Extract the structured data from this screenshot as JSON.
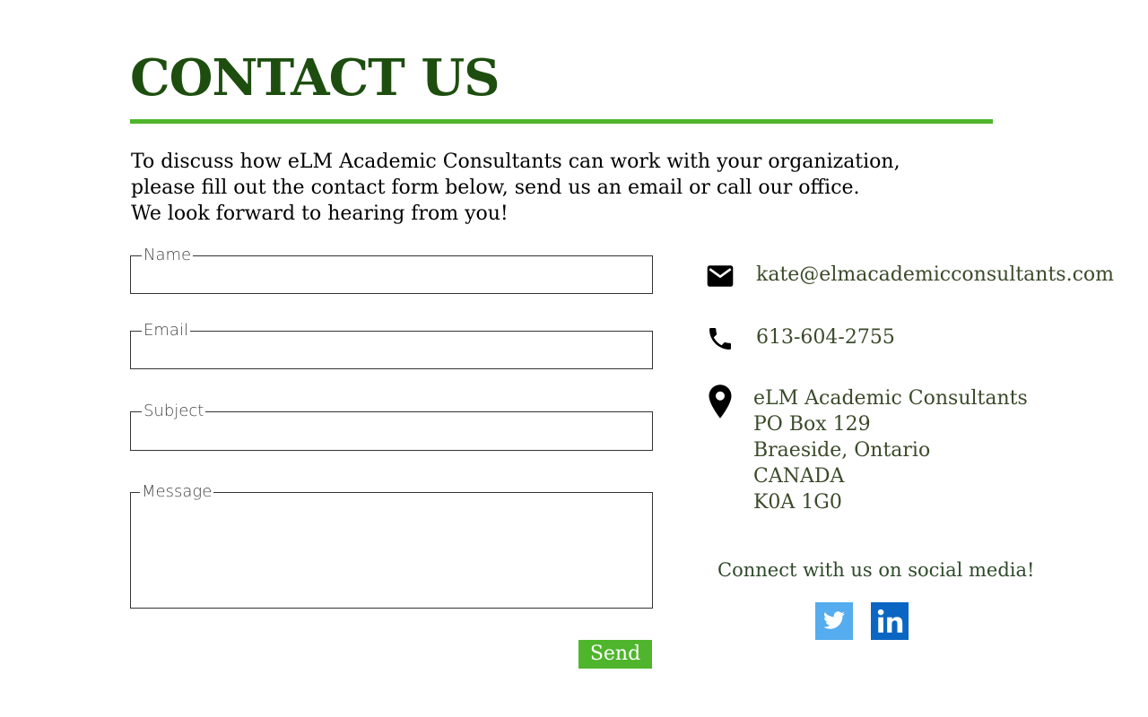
{
  "page": {
    "title": "CONTACT US",
    "intro_lines": [
      "To discuss how eLM Academic Consultants can work with your organization,",
      "please fill out the contact form below, send us an email or call our office.",
      "We look forward to hearing from you!"
    ]
  },
  "form": {
    "name_label": "Name",
    "name_value": "",
    "email_label": "Email",
    "email_value": "",
    "subject_label": "Subject",
    "subject_value": "",
    "message_label": "Message",
    "message_value": "",
    "send_label": "Send"
  },
  "contact": {
    "email": "kate@elmacademicconsultants.com",
    "phone": "613-604-2755",
    "address_lines": [
      "eLM Academic Consultants",
      "PO Box 129",
      "Braeside, Ontario",
      "CANADA",
      "K0A 1G0"
    ],
    "icons": [
      "mail-icon",
      "phone-icon",
      "location-pin-icon"
    ]
  },
  "social": {
    "heading": "Connect with us on social media!",
    "links": [
      {
        "name": "twitter-icon",
        "color": "#55acee"
      },
      {
        "name": "linkedin-icon",
        "color": "#0a66c2"
      }
    ]
  },
  "colors": {
    "title": "#1d4e0f",
    "accent": "#4fb52c",
    "contact_text": "#3a4a2a"
  }
}
